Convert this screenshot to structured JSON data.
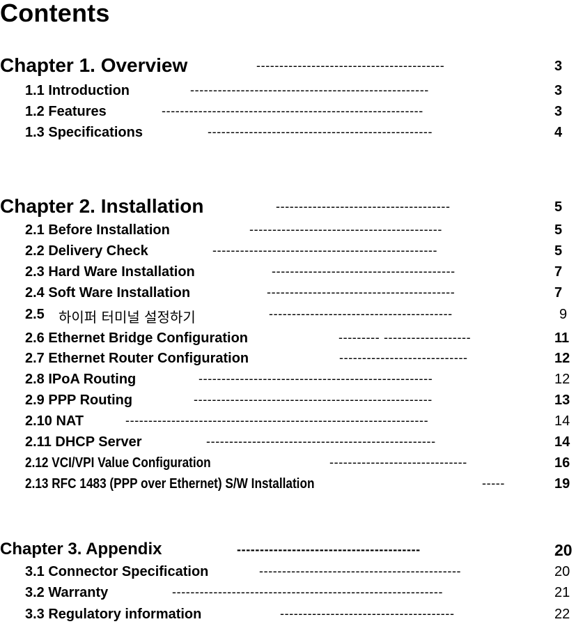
{
  "document": {
    "title": "Contents"
  },
  "toc": [
    {
      "kind": "chapter",
      "number": "Chapter 1.",
      "title": "Overview",
      "label": "Chapter 1. Overview",
      "leader": "-----------------------------------------",
      "page": "3",
      "page_bold": true
    },
    {
      "kind": "section",
      "label": "1.1 Introduction",
      "leader": "----------------------------------------------------",
      "page": "3",
      "page_bold": true
    },
    {
      "kind": "section",
      "label": "1.2 Features",
      "leader": "---------------------------------------------------------",
      "page": "3",
      "page_bold": true
    },
    {
      "kind": "section",
      "label": "1.3 Specifications",
      "leader": "-------------------------------------------------",
      "page": "4",
      "page_bold": true
    },
    {
      "kind": "chapter",
      "number": "Chapter 2.",
      "title": "Installation",
      "label": "Chapter 2. Installation",
      "leader": "--------------------------------------",
      "page": "5",
      "page_bold": true
    },
    {
      "kind": "section",
      "label": "2.1 Before Installation",
      "leader": "------------------------------------------",
      "page": "5",
      "page_bold": true
    },
    {
      "kind": "section",
      "label": "2.2 Delivery Check",
      "leader": "-------------------------------------------------",
      "page": "5",
      "page_bold": true
    },
    {
      "kind": "section",
      "label": "2.3 Hard Ware Installation",
      "leader": "----------------------------------------",
      "page": "7",
      "page_bold": true
    },
    {
      "kind": "section",
      "label": "2.4 Soft Ware Installation",
      "leader": "-----------------------------------------",
      "page": "7",
      "page_bold": true
    },
    {
      "kind": "section",
      "number": "2.5",
      "title_korean": "하이퍼 터미널 설정하기",
      "label": "2.5",
      "leader": "----------------------------------------",
      "page": "9",
      "page_bold": false
    },
    {
      "kind": "section",
      "label": "2.6 Ethernet Bridge Configuration",
      "leader": "--------- -------------------",
      "page": "11",
      "page_bold": true
    },
    {
      "kind": "section",
      "label": "2.7 Ethernet Router Configuration",
      "leader": "----------------------------",
      "page": "12",
      "page_bold": true
    },
    {
      "kind": "section",
      "label": "2.8 IPoA Routing",
      "leader": "---------------------------------------------------",
      "page": "12",
      "page_bold": false
    },
    {
      "kind": "section",
      "label": "2.9 PPP Routing",
      "leader": "----------------------------------------------------",
      "page": "13",
      "page_bold": true
    },
    {
      "kind": "section",
      "label": "2.10 NAT",
      "leader": "------------------------------------------------------------------",
      "page": "14",
      "page_bold": false
    },
    {
      "kind": "section",
      "label": "2.11 DHCP Server",
      "leader": "--------------------------------------------------",
      "page": "14",
      "page_bold": true
    },
    {
      "kind": "section",
      "label": "2.12 VCI/VPI Value Configuration",
      "leader": "------------------------------",
      "page": "16",
      "page_bold": true
    },
    {
      "kind": "section",
      "label": "2.13 RFC 1483 (PPP over Ethernet) S/W Installation",
      "leader": "-----",
      "page": "19",
      "page_bold": true
    },
    {
      "kind": "chapter",
      "number": "Chapter 3.",
      "title": "Appendix",
      "label": "Chapter 3. Appendix",
      "leader": "----------------------------------------",
      "page": "20",
      "page_bold": true
    },
    {
      "kind": "section",
      "label": "3.1 Connector Specification",
      "leader": "--------------------------------------------",
      "page": "20",
      "page_bold": false
    },
    {
      "kind": "section",
      "label": "3.2 Warranty",
      "leader": "-----------------------------------------------------------",
      "page": "21",
      "page_bold": false
    },
    {
      "kind": "section",
      "label": "3.3 Regulatory information",
      "leader": "--------------------------------------",
      "page": "22",
      "page_bold": false
    }
  ]
}
